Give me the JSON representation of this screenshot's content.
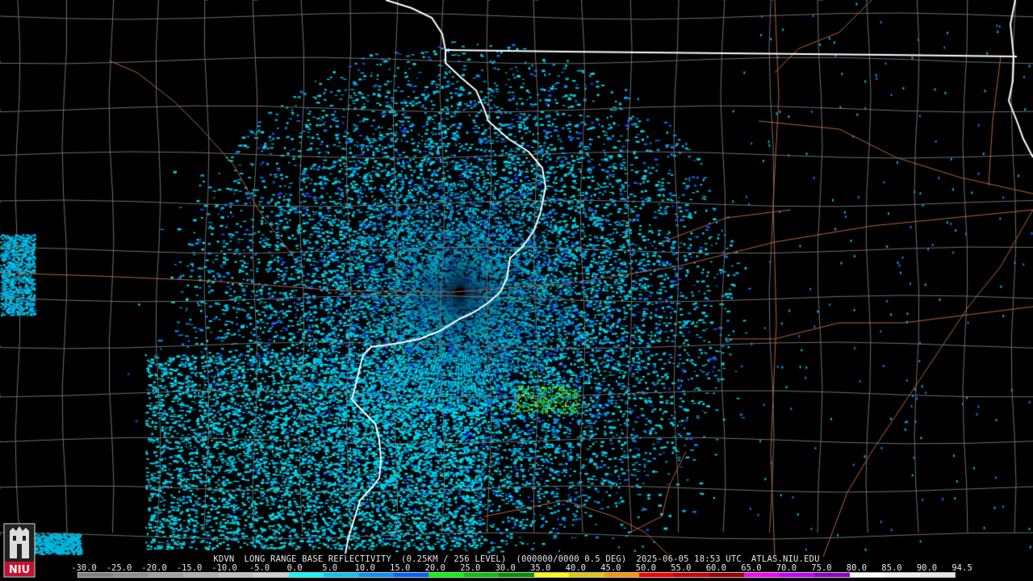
{
  "product": {
    "station": "KDVN",
    "product_name": "LONG RANGE BASE REFLECTIVITY",
    "resolution": "(0.25KM / 256 LEVEL)",
    "volume": "(000000/0000 0.5 DEG)",
    "datetime": "2025-06-05 18:53 UTC",
    "site": "ATLAS.NIU.EDU"
  },
  "logo": {
    "text": "NIU",
    "color": "#c8102e"
  },
  "scale": {
    "labels": [
      "-30.0",
      "-25.0",
      "-20.0",
      "-15.0",
      "-10.0",
      "-5.0",
      "0.0",
      "5.0",
      "10.0",
      "15.0",
      "20.0",
      "25.0",
      "30.0",
      "35.0",
      "40.0",
      "45.0",
      "50.0",
      "55.0",
      "60.0",
      "65.0",
      "70.0",
      "75.0",
      "80.0",
      "85.0",
      "90.0",
      "94.5"
    ],
    "colors": [
      "#7f7f7f",
      "#8f8f8f",
      "#9f9f9f",
      "#afafaf",
      "#bfbfbf",
      "#cfcfcf",
      "#00ffff",
      "#00c8ff",
      "#0096ff",
      "#0064ff",
      "#00ff00",
      "#00c800",
      "#009600",
      "#ffff00",
      "#e6c800",
      "#ff9600",
      "#ff0000",
      "#d20000",
      "#a00000",
      "#ff00ff",
      "#c800ff",
      "#9600c8",
      "#ffffff",
      "#f0f0f0",
      "#e6e6e6"
    ]
  },
  "colors": {
    "background": "#000000",
    "county_lines": "#6e6e6e",
    "state_lines": "#ffffff",
    "roads": "#b4643c",
    "echo_primary": "#00d0e0"
  }
}
